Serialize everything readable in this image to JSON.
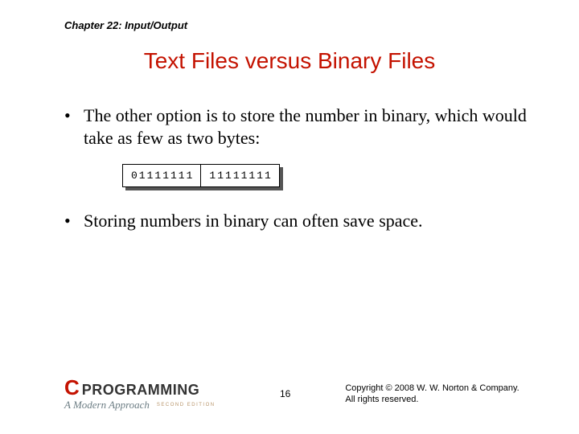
{
  "chapter": "Chapter 22: Input/Output",
  "title": "Text Files versus Binary Files",
  "bullets": [
    "The other option is to store the number in binary, which would take as few as two bytes:",
    "Storing numbers in binary can often save space."
  ],
  "binary_cells": [
    "01111111",
    "11111111"
  ],
  "logo": {
    "c": "C",
    "word": "PROGRAMMING",
    "subtitle": "A Modern Approach",
    "edition": "SECOND EDITION"
  },
  "page_number": "16",
  "copyright_line1": "Copyright © 2008 W. W. Norton & Company.",
  "copyright_line2": "All rights reserved."
}
